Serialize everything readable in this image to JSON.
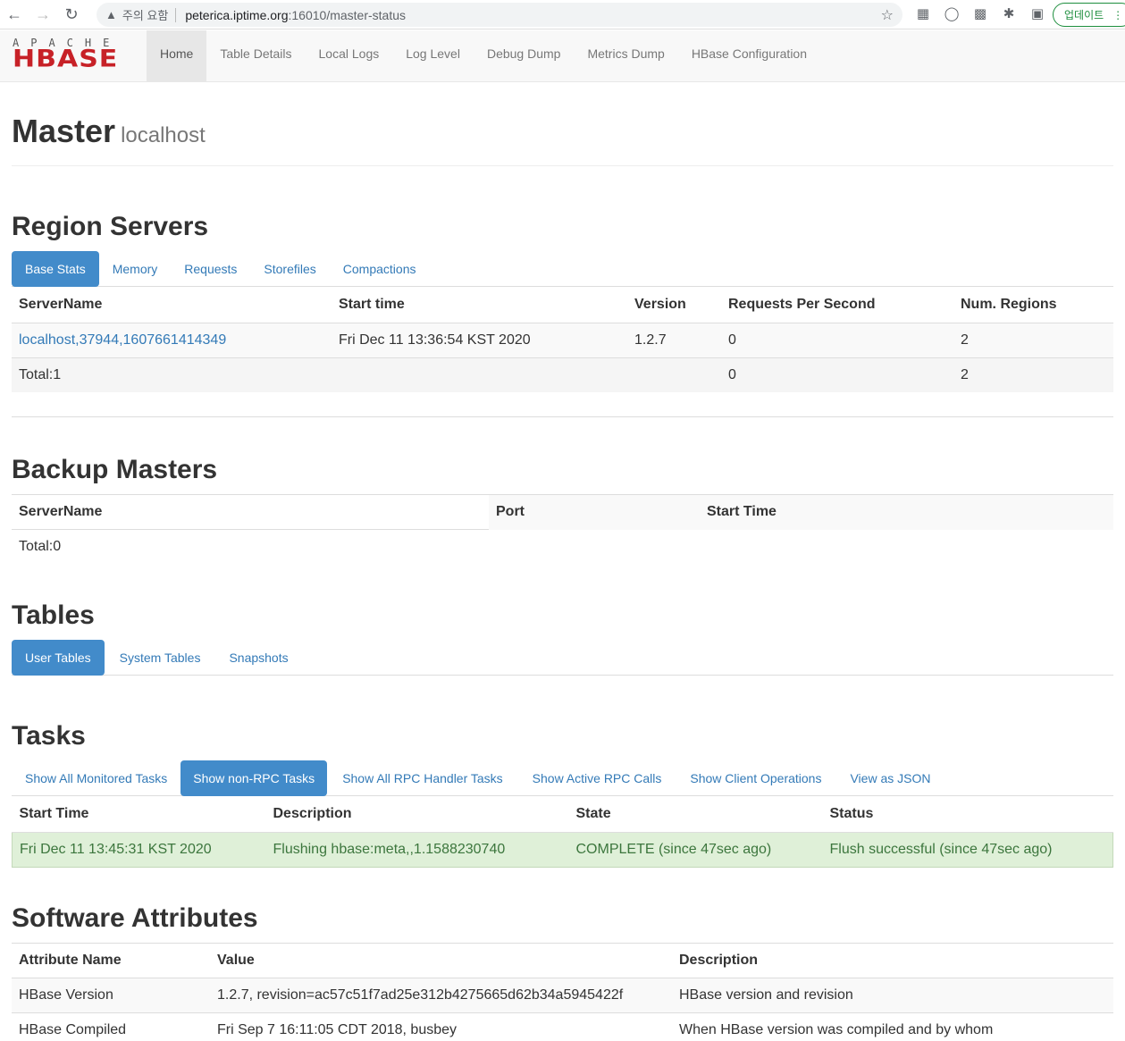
{
  "browser": {
    "not_secure": "주의 요함",
    "url_host": "peterica.iptime.org",
    "url_path": ":16010/master-status",
    "update_label": "업데이트"
  },
  "navbar": {
    "logo_top": "APACHE",
    "logo_main": "HBASE",
    "links": [
      "Home",
      "Table Details",
      "Local Logs",
      "Log Level",
      "Debug Dump",
      "Metrics Dump",
      "HBase Configuration"
    ]
  },
  "header": {
    "title": "Master",
    "subtitle": "localhost"
  },
  "region_servers": {
    "title": "Region Servers",
    "tabs": [
      "Base Stats",
      "Memory",
      "Requests",
      "Storefiles",
      "Compactions"
    ],
    "columns": [
      "ServerName",
      "Start time",
      "Version",
      "Requests Per Second",
      "Num. Regions"
    ],
    "rows": [
      {
        "server": "localhost,37944,1607661414349",
        "start": "Fri Dec 11 13:36:54 KST 2020",
        "version": "1.2.7",
        "rps": "0",
        "regions": "2"
      }
    ],
    "total": {
      "label": "Total:1",
      "rps": "0",
      "regions": "2"
    }
  },
  "backup_masters": {
    "title": "Backup Masters",
    "columns": [
      "ServerName",
      "Port",
      "Start Time"
    ],
    "total": "Total:0"
  },
  "tables": {
    "title": "Tables",
    "tabs": [
      "User Tables",
      "System Tables",
      "Snapshots"
    ]
  },
  "tasks": {
    "title": "Tasks",
    "tabs": [
      "Show All Monitored Tasks",
      "Show non-RPC Tasks",
      "Show All RPC Handler Tasks",
      "Show Active RPC Calls",
      "Show Client Operations",
      "View as JSON"
    ],
    "columns": [
      "Start Time",
      "Description",
      "State",
      "Status"
    ],
    "rows": [
      {
        "start": "Fri Dec 11 13:45:31 KST 2020",
        "desc": "Flushing hbase:meta,,1.1588230740",
        "state": "COMPLETE (since 47sec ago)",
        "status": "Flush successful (since 47sec ago)"
      }
    ]
  },
  "software": {
    "title": "Software Attributes",
    "columns": [
      "Attribute Name",
      "Value",
      "Description"
    ],
    "rows": [
      {
        "name": "HBase Version",
        "value": "1.2.7, revision=ac57c51f7ad25e312b4275665d62b34a5945422f",
        "desc": "HBase version and revision"
      },
      {
        "name": "HBase Compiled",
        "value": "Fri Sep 7 16:11:05 CDT 2018, busbey",
        "desc": "When HBase version was compiled and by whom"
      }
    ]
  }
}
